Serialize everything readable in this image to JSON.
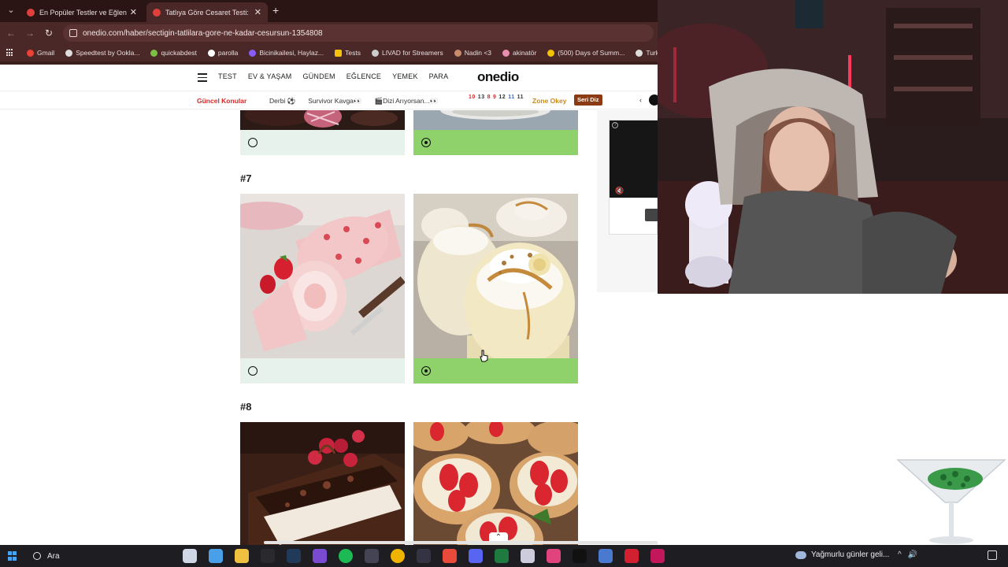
{
  "browser": {
    "tabs": [
      {
        "title": "En Popüler Testler ve Eğlenceli",
        "active": false
      },
      {
        "title": "Tatlıya Göre Cesaret Testi: Sen N",
        "active": true
      }
    ],
    "url": "onedio.com/haber/sectigin-tatlilara-gore-ne-kadar-cesursun-1354808",
    "bookmarks": [
      "Gmail",
      "Speedtest by Ookla...",
      "quickabdest",
      "parolla",
      "Bicinikailesi, Haylaz...",
      "Tests",
      "LIVAD for Streamers",
      "Nadin <3",
      "akinatör",
      "(500) Days of Summ...",
      "TurkeyVisited"
    ]
  },
  "site": {
    "logo": "onedio",
    "nav": [
      "TEST",
      "EV & YAŞAM",
      "GÜNDEM",
      "EĞLENCE",
      "YEMEK",
      "PARA"
    ],
    "topics_label": "Güncel Konular",
    "topics": [
      "Derbi ⚽",
      "Survivor Kavga👀",
      "🎬Dizi Arıyorsan...👀"
    ],
    "calendar_nums": [
      "10",
      "13",
      "8",
      "9",
      "12",
      "11",
      "11"
    ],
    "zone": "Zone Okey",
    "seri_diz": "Seri Diz"
  },
  "quiz": {
    "q7_label": "#7",
    "q8_label": "#8",
    "q6": {
      "left_selected": false,
      "right_selected": true
    },
    "q7": {
      "left_selected": false,
      "right_selected": true
    },
    "colors": {
      "selected": "#8fd16a",
      "unselected": "#e7f2ec"
    }
  },
  "taskbar": {
    "search": "Ara",
    "weather": "Yağmurlu günler geli..."
  }
}
